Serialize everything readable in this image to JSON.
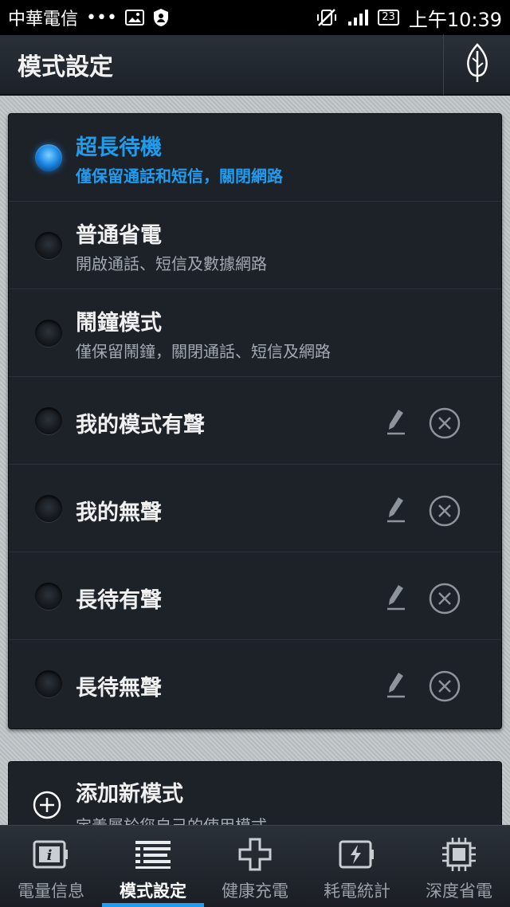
{
  "status_bar": {
    "carrier": "中華電信",
    "dots": "•••",
    "battery_level": "23",
    "time": "上午10:39"
  },
  "header": {
    "title": "模式設定",
    "leaf_icon": "leaf-icon"
  },
  "modes": [
    {
      "title": "超長待機",
      "desc": "僅保留通話和短信，關閉網路",
      "selected": true
    },
    {
      "title": "普通省電",
      "desc": "開啟通話、短信及數據網路",
      "selected": false
    },
    {
      "title": "鬧鐘模式",
      "desc": "僅保留鬧鐘，關閉通話、短信及網路",
      "selected": false
    },
    {
      "title": "我的模式有聲",
      "selected": false
    },
    {
      "title": "我的無聲",
      "selected": false
    },
    {
      "title": "長待有聲",
      "selected": false
    },
    {
      "title": "長待無聲",
      "selected": false
    }
  ],
  "add_mode": {
    "title": "添加新模式",
    "desc": "定義屬於您自己的使用模式"
  },
  "bottom_nav": [
    {
      "label": "電量信息",
      "icon": "battery-info-icon"
    },
    {
      "label": "模式設定",
      "icon": "mode-list-icon",
      "active": true
    },
    {
      "label": "健康充電",
      "icon": "health-charge-icon"
    },
    {
      "label": "耗電統計",
      "icon": "power-stats-icon"
    },
    {
      "label": "深度省電",
      "icon": "chip-icon"
    }
  ],
  "colors": {
    "accent": "#1e9cf0",
    "card_bg": "#1d2229",
    "header_bg": "#232931"
  }
}
